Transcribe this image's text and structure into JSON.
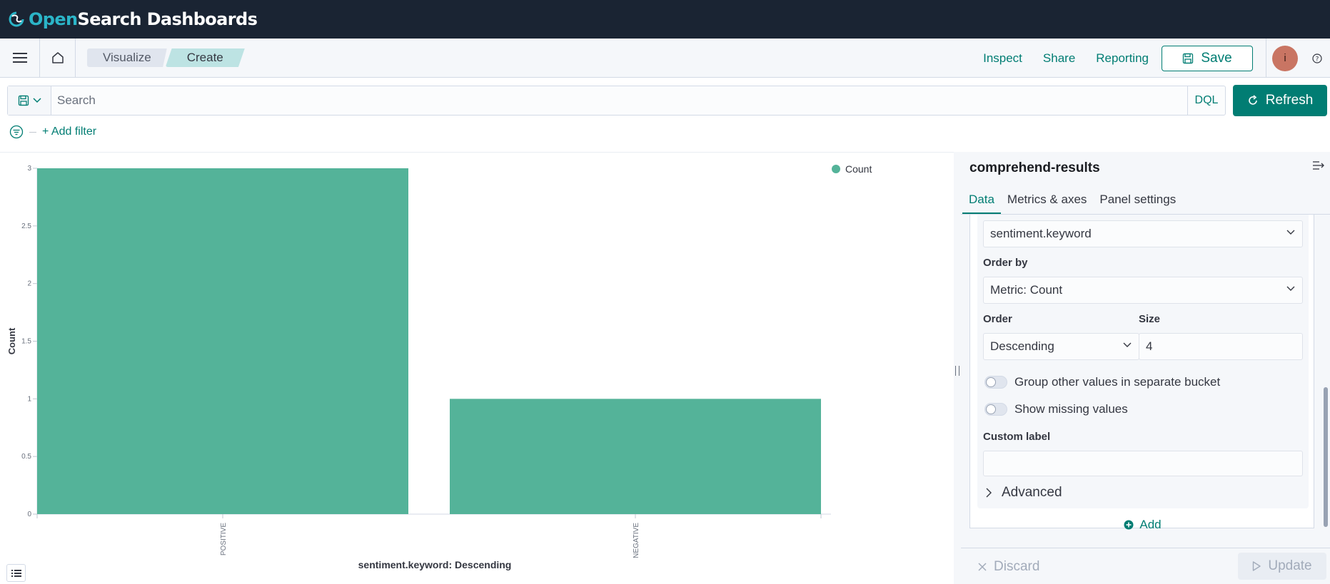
{
  "header": {
    "logo_open": "Open",
    "logo_search": "Search",
    "logo_dashboards": " Dashboards"
  },
  "nav": {
    "breadcrumbs": [
      "Visualize",
      "Create"
    ],
    "links": {
      "inspect": "Inspect",
      "share": "Share",
      "reporting": "Reporting"
    },
    "save_label": "Save",
    "avatar_initial": "i"
  },
  "query": {
    "placeholder": "Search",
    "language": "DQL",
    "refresh_label": "Refresh"
  },
  "filters": {
    "add_filter_label": "+ Add filter"
  },
  "chart_data": {
    "type": "bar",
    "categories": [
      "POSITIVE",
      "NEGATIVE"
    ],
    "series": [
      {
        "name": "Count",
        "values": [
          3,
          1
        ]
      }
    ],
    "ylabel": "Count",
    "xlabel": "sentiment.keyword: Descending",
    "yticks": [
      "0",
      "0.5",
      "1",
      "1.5",
      "2",
      "2.5",
      "3"
    ],
    "ylim": [
      0,
      3
    ],
    "legend": "top-right",
    "color": "#54b399"
  },
  "sidebar": {
    "title": "comprehend-results",
    "tabs": [
      {
        "label": "Data"
      },
      {
        "label": "Metrics & axes"
      },
      {
        "label": "Panel settings"
      }
    ],
    "field_value": "sentiment.keyword",
    "order_by_label": "Order by",
    "order_by_value": "Metric: Count",
    "order_label": "Order",
    "order_value": "Descending",
    "size_label": "Size",
    "size_value": "4",
    "group_other_label": "Group other values in separate bucket",
    "show_missing_label": "Show missing values",
    "custom_label_label": "Custom label",
    "custom_label_value": "",
    "advanced_label": "Advanced",
    "add_label": "Add",
    "discard_label": "Discard",
    "update_label": "Update"
  }
}
